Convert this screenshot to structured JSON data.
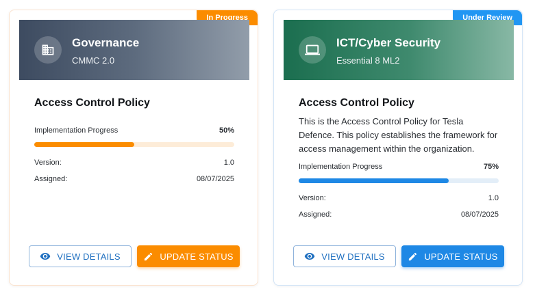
{
  "cards": [
    {
      "badge": "In Progress",
      "category": "Governance",
      "framework": "CMMC 2.0",
      "category_icon": "building-icon",
      "title": "Access Control Policy",
      "description": "",
      "progress_label": "Implementation Progress",
      "progress_value": "50%",
      "progress_fraction": 0.5,
      "version_label": "Version:",
      "version_value": "1.0",
      "assigned_label": "Assigned:",
      "assigned_value": "08/07/2025",
      "view_button": "VIEW DETAILS",
      "update_button": "UPDATE STATUS",
      "accent_color": "#fb8c00"
    },
    {
      "badge": "Under Review",
      "category": "ICT/Cyber Security",
      "framework": "Essential 8 ML2",
      "category_icon": "laptop-icon",
      "title": "Access Control Policy",
      "description": "This is the Access Control Policy for Tesla Defence. This policy establishes the framework for access management within the organization.",
      "progress_label": "Implementation Progress",
      "progress_value": "75%",
      "progress_fraction": 0.75,
      "version_label": "Version:",
      "version_value": "1.0",
      "assigned_label": "Assigned:",
      "assigned_value": "08/07/2025",
      "view_button": "VIEW DETAILS",
      "update_button": "UPDATE STATUS",
      "accent_color": "#1e88e5"
    }
  ]
}
